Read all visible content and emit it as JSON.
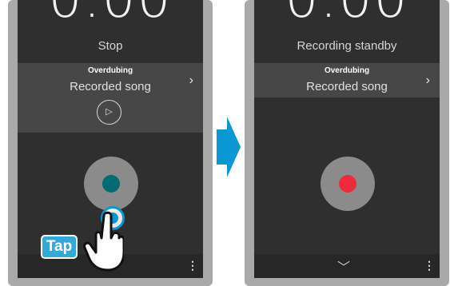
{
  "left_screen": {
    "time": "0.00",
    "status": "Stop",
    "panel_title": "Overdubing",
    "panel_song": "Recorded song",
    "chevron_right": "›",
    "play_icon": "▷",
    "record_color": "#006b70",
    "chevron_down": "﹀",
    "more_menu": "⋮"
  },
  "right_screen": {
    "time": "0.00",
    "status": "Recording standby",
    "panel_title": "Overdubing",
    "panel_song": "Recorded song",
    "chevron_right": "›",
    "record_color": "#ee2a3c",
    "chevron_down": "﹀",
    "more_menu": "⋮"
  },
  "annotation": {
    "tap_label": "Tap",
    "arrow_color": "#0b97d4"
  }
}
